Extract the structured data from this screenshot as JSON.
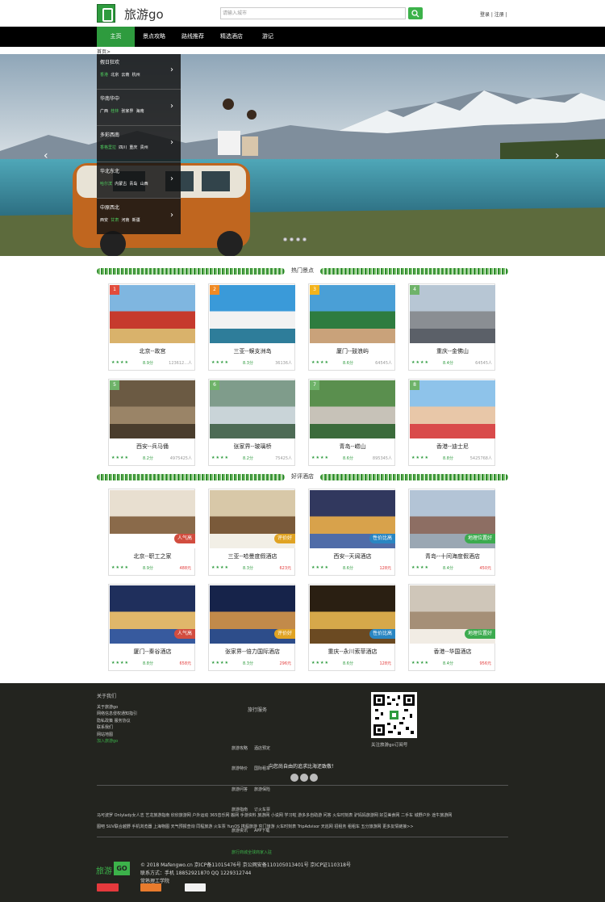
{
  "header": {
    "site_title": "旅游go",
    "search_placeholder": "请输入城市",
    "login": "登录 | 注册 |"
  },
  "nav": {
    "items": [
      "主页",
      "景点攻略",
      "路线推荐",
      "精选酒店",
      "游记"
    ]
  },
  "breadcrumb": "首页>",
  "sidemenu": [
    {
      "title": "假日狂欢",
      "links": [
        {
          "t": "香港",
          "hi": true
        },
        {
          "t": "北京"
        },
        {
          "t": "云南"
        },
        {
          "t": "杭州"
        }
      ]
    },
    {
      "title": "华南华中",
      "links": [
        {
          "t": "广西"
        },
        {
          "t": "桂林",
          "hi": true
        },
        {
          "t": "张家界"
        },
        {
          "t": "海南"
        }
      ]
    },
    {
      "title": "多彩西南",
      "links": [
        {
          "t": "香格里拉",
          "hi": true
        },
        {
          "t": "四川"
        },
        {
          "t": "重庆"
        },
        {
          "t": "贵州"
        }
      ]
    },
    {
      "title": "华北东北",
      "links": [
        {
          "t": "哈尔滨",
          "hi": true
        },
        {
          "t": "内蒙古"
        },
        {
          "t": "青岛"
        },
        {
          "t": "山西"
        }
      ]
    },
    {
      "title": "中原西北",
      "links": [
        {
          "t": "西安"
        },
        {
          "t": "甘肃",
          "hi": true
        },
        {
          "t": "河南"
        },
        {
          "t": "新疆"
        }
      ]
    }
  ],
  "sections": {
    "spots_title": "热门景点",
    "hotels_title": "好评酒店"
  },
  "spots": [
    {
      "rank": "1",
      "name": "北京--故宫",
      "stars": "★★★★",
      "score": "8.9分",
      "count": "123612...人"
    },
    {
      "rank": "2",
      "name": "三亚--蜈支洲岛",
      "stars": "★★★★",
      "score": "8.3分",
      "count": "36136人"
    },
    {
      "rank": "3",
      "name": "厦门--鼓浪屿",
      "stars": "★★★★",
      "score": "8.6分",
      "count": "64545人"
    },
    {
      "rank": "4",
      "name": "重庆--金佛山",
      "stars": "★★★★",
      "score": "8.4分",
      "count": "64545人"
    },
    {
      "rank": "5",
      "name": "西安--兵马俑",
      "stars": "★★★★",
      "score": "8.2分",
      "count": "4975425人"
    },
    {
      "rank": "6",
      "name": "张家界--玻璃桥",
      "stars": "★★★★",
      "score": "8.2分",
      "count": "75425人"
    },
    {
      "rank": "7",
      "name": "青岛--崂山",
      "stars": "★★★★",
      "score": "8.6分",
      "count": "895345人"
    },
    {
      "rank": "8",
      "name": "香港--迪士尼",
      "stars": "★★★★",
      "score": "8.8分",
      "count": "5425768人"
    }
  ],
  "hotels": [
    {
      "name": "北京--职工之家",
      "stars": "★★★★",
      "score": "8.9分",
      "price": "488元",
      "tag": "人气高",
      "tag_color": "#d24d3f"
    },
    {
      "name": "三亚--哈曼度假酒店",
      "stars": "★★★★",
      "score": "8.3分",
      "price": "623元",
      "tag": "评价好",
      "tag_color": "#e0a323"
    },
    {
      "name": "西安--天阔酒店",
      "stars": "★★★★",
      "score": "8.6分",
      "price": "128元",
      "tag": "性价比高",
      "tag_color": "#2a86c2"
    },
    {
      "name": "青岛--十间海度假酒店",
      "stars": "★★★★",
      "score": "8.4分",
      "price": "450元",
      "tag": "地理位置好",
      "tag_color": "#3cab4f"
    },
    {
      "name": "厦门--秦谷酒店",
      "stars": "★★★★",
      "score": "8.8分",
      "price": "658元",
      "tag": "人气高",
      "tag_color": "#d24d3f"
    },
    {
      "name": "张家界--倍力国际酒店",
      "stars": "★★★★",
      "score": "8.3分",
      "price": "296元",
      "tag": "评价好",
      "tag_color": "#e0a323"
    },
    {
      "name": "重庆--永川索菲酒店",
      "stars": "★★★★",
      "score": "8.6分",
      "price": "128元",
      "tag": "性价比高",
      "tag_color": "#2a86c2"
    },
    {
      "name": "香港--华国酒店",
      "stars": "★★★★",
      "score": "8.4分",
      "price": "956元",
      "tag": "地理位置好",
      "tag_color": "#3cab4f"
    }
  ],
  "footer": {
    "about_title": "关于我们",
    "about_links": [
      "关于旅游go",
      "网络信息侵权通知指引",
      "隐私政策  服务协议",
      "联系我们",
      "网站地图"
    ],
    "join": "加入旅游go",
    "service_title": "旅行服务",
    "service_links": [
      "旅游攻略     酒店预定",
      "旅游特价     国际租车",
      "旅游问答     旅游保险",
      "旅游指南     订火车票",
      "旅游资讯     APP下载"
    ],
    "service_join": "旅行商城全球商家入驻",
    "qr_label": "关注旅游go订阅号",
    "slogan": "向您尚自由的追求比海还致敬！",
    "links_line1": "马可波罗 Onlylady女人志 艺龙旅游指南 欣欣旅游网 户外运动 365音乐网 搬网 手游资料 旅游网 小说网 学习啦 游多多自助游 问答 火车时刻表 驴妈妈旅游网 好豆美食网 二手车 城野户外 途牛旅游网",
    "links_line2": "图吧 SUV联合越野 手机浏览器 上海物图 天气预报查询 同程旅游 火车票 YunOS 携程旅游 穷门旅游 火车时刻表 TripAdvisor 天巡网 招租务 租租车 五分旅游网 更多友情链接>>",
    "logo_text": "旅游",
    "logo_go": "GO",
    "copy1": "© 2018 Mafengwo.cn 京ICP备11015476号 京公网安备110105013401号 京ICP证110318号",
    "copy2": "联系方式：手机 18852921870 QQ 1229312744",
    "copy3": "常熟理工学院"
  }
}
